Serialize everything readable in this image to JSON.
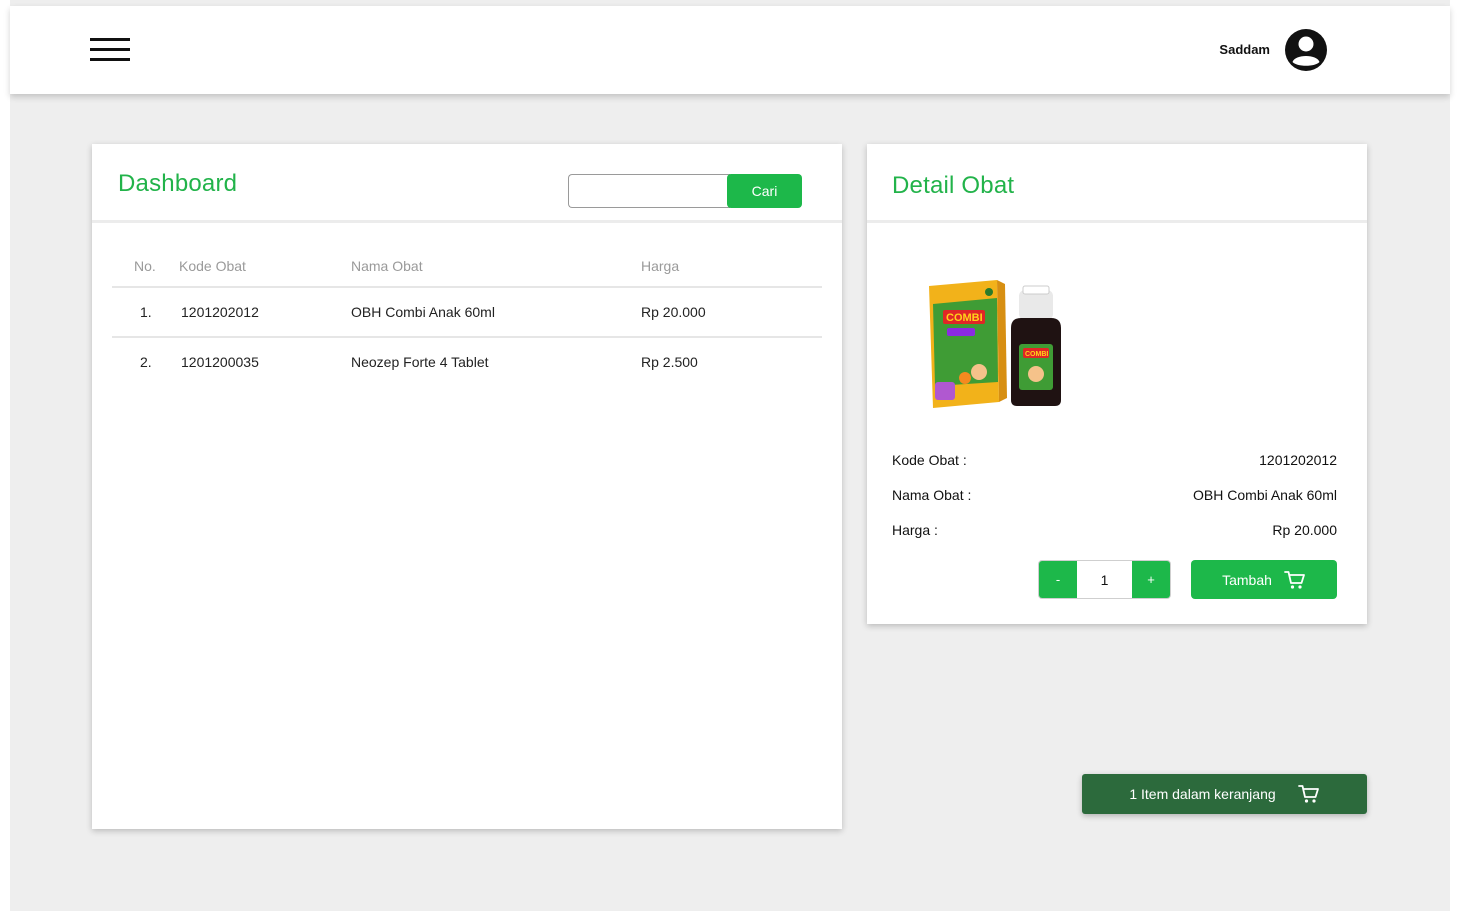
{
  "header": {
    "menu_icon": "hamburger-menu-icon",
    "username": "Saddam",
    "avatar_icon": "user-circle-icon"
  },
  "dashboard": {
    "title": "Dashboard",
    "search": {
      "placeholder": "",
      "value": "",
      "button_label": "Cari"
    },
    "columns": [
      "No.",
      "Kode Obat",
      "Nama Obat",
      "Harga"
    ],
    "rows": [
      {
        "no": "1.",
        "kode": "1201202012",
        "nama": "OBH Combi Anak 60ml",
        "harga": "Rp 20.000"
      },
      {
        "no": "2.",
        "kode": "1201200035",
        "nama": "Neozep Forte 4 Tablet",
        "harga": "Rp 2.500"
      }
    ]
  },
  "detail": {
    "title": "Detail Obat",
    "image_alt": "OBH Combi Anak product image",
    "fields": [
      {
        "label": "Kode Obat :",
        "value": "1201202012"
      },
      {
        "label": "Nama Obat :",
        "value": "OBH Combi Anak 60ml"
      },
      {
        "label": "Harga :",
        "value": "Rp 20.000"
      }
    ],
    "quantity": {
      "minus_label": "-",
      "value": "1",
      "plus_label": "+"
    },
    "add_button_label": "Tambah",
    "add_button_icon": "cart-icon"
  },
  "cart": {
    "label": "1 Item dalam keranjang",
    "icon": "cart-icon"
  },
  "colors": {
    "accent_green": "#1db84a",
    "title_green": "#22b34a",
    "cart_bar": "#2c6a3c",
    "background": "#eeeeee"
  }
}
